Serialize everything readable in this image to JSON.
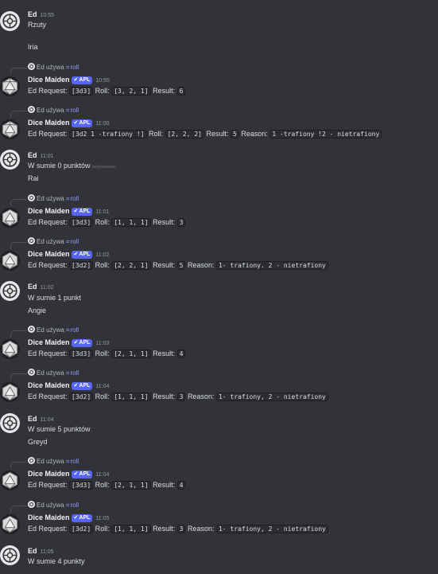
{
  "labels": {
    "ed_request": "Ed Request:",
    "roll": "Roll:",
    "result": "Result:",
    "reason": "Reason:",
    "uses": "Ed używa",
    "command": "roll",
    "app_badge": "APL",
    "edited": "(edytowane)"
  },
  "messages": [
    {
      "author": "Ed",
      "time": "10:55",
      "lines": [
        "Rzuty",
        "",
        "Iria"
      ]
    },
    {
      "author": "Dice Maiden",
      "time": "10:55",
      "request": "[3d3]",
      "roll": "[3, 2, 1]",
      "result": "6"
    },
    {
      "author": "Dice Maiden",
      "time": "11:00",
      "request": "[3d2 1 -trafiony !]",
      "roll": "[2, 2, 2]",
      "result": "5",
      "reason": "1 -trafiony !2 - nietrafiony"
    },
    {
      "author": "Ed",
      "time": "11:01",
      "lines": [
        "W sumie 0 punktów",
        "Rai"
      ]
    },
    {
      "author": "Dice Maiden",
      "time": "11:01",
      "request": "[3d3]",
      "roll": "[1, 1, 1]",
      "result": "3"
    },
    {
      "author": "Dice Maiden",
      "time": "11:02",
      "request": "[3d2]",
      "roll": "[2, 2, 1]",
      "result": "5",
      "reason": "1- trafiony. 2 - nietrafiony"
    },
    {
      "author": "Ed",
      "time": "11:02",
      "lines": [
        "W sumie 1 punkt",
        "Angie"
      ]
    },
    {
      "author": "Dice Maiden",
      "time": "11:03",
      "request": "[3d3]",
      "roll": "[2, 1, 1]",
      "result": "4"
    },
    {
      "author": "Dice Maiden",
      "time": "11:04",
      "request": "[3d2]",
      "roll": "[1, 1, 1]",
      "result": "3",
      "reason": "1- trafiony, 2 - nietrafiony"
    },
    {
      "author": "Ed",
      "time": "11:04",
      "lines": [
        "W sumie 5 punktów",
        "Greyd"
      ]
    },
    {
      "author": "Dice Maiden",
      "time": "11:04",
      "request": "[3d3]",
      "roll": "[2, 1, 1]",
      "result": "4"
    },
    {
      "author": "Dice Maiden",
      "time": "11:05",
      "request": "[3d2]",
      "roll": "[1, 1, 1]",
      "result": "3",
      "reason": "1- trafiony, 2 - nietrafiony"
    },
    {
      "author": "Ed",
      "time": "11:05",
      "lines": [
        "W sumie 4 punkty"
      ]
    }
  ]
}
